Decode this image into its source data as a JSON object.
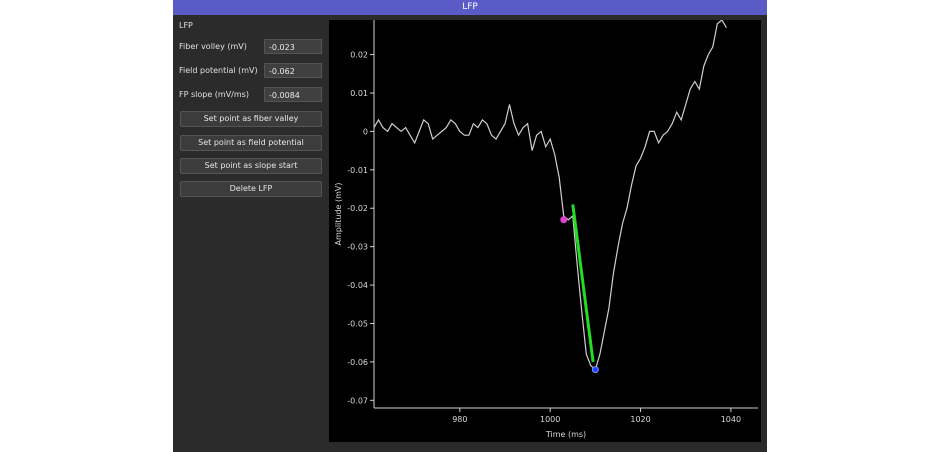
{
  "window": {
    "title": "LFP"
  },
  "panel": {
    "title": "LFP",
    "rows": [
      {
        "label": "Fiber volley (mV)",
        "value": "-0.023"
      },
      {
        "label": "Field potential (mV)",
        "value": "-0.062"
      },
      {
        "label": "FP slope (mV/ms)",
        "value": "-0.0084"
      }
    ],
    "buttons": [
      "Set point as fiber valley",
      "Set point as field potential",
      "Set point as slope start",
      "Delete LFP"
    ]
  },
  "chart_data": {
    "type": "line",
    "xlabel": "Time (ms)",
    "ylabel": "Amplitude (mV)",
    "xlim": [
      961,
      1046
    ],
    "ylim": [
      -0.072,
      0.029
    ],
    "xticks": [
      980,
      1000,
      1020,
      1040
    ],
    "yticks": [
      0.02,
      0.01,
      0,
      -0.01,
      -0.02,
      -0.03,
      -0.04,
      -0.05,
      -0.06,
      -0.07
    ],
    "colors": {
      "trace": "#cfcfcf",
      "slope": "#22dd22",
      "fiber_marker": "#e040d0",
      "fp_marker": "#2040ff"
    },
    "series": [
      {
        "x": [
          961,
          962,
          963,
          964,
          965,
          966,
          967,
          968,
          969,
          970,
          971,
          972,
          973,
          974,
          975,
          976,
          977,
          978,
          979,
          980,
          981,
          982,
          983,
          984,
          985,
          986,
          987,
          988,
          989,
          990,
          991,
          992,
          993,
          994,
          995,
          996,
          997,
          998,
          999,
          1000,
          1001,
          1002,
          1003,
          1004,
          1005,
          1006,
          1007,
          1008,
          1009,
          1010,
          1011,
          1012,
          1013,
          1014,
          1015,
          1016,
          1017,
          1018,
          1019,
          1020,
          1021,
          1022,
          1023,
          1024,
          1025,
          1026,
          1027,
          1028,
          1029,
          1030,
          1031,
          1032,
          1033,
          1034,
          1035,
          1036,
          1037,
          1038,
          1039
        ],
        "y": [
          0.001,
          0.003,
          0.001,
          0.0,
          0.002,
          0.001,
          0.0,
          0.001,
          -0.001,
          -0.003,
          0.0,
          0.003,
          0.002,
          -0.002,
          -0.001,
          0.0,
          0.001,
          0.003,
          0.002,
          0.0,
          -0.001,
          -0.001,
          0.002,
          0.001,
          0.003,
          0.002,
          -0.001,
          -0.002,
          0.0,
          0.002,
          0.007,
          0.002,
          -0.001,
          0.001,
          0.002,
          -0.005,
          -0.001,
          0.0,
          -0.004,
          -0.002,
          -0.006,
          -0.012,
          -0.022,
          -0.023,
          -0.022,
          -0.035,
          -0.047,
          -0.058,
          -0.061,
          -0.062,
          -0.058,
          -0.052,
          -0.046,
          -0.037,
          -0.03,
          -0.024,
          -0.02,
          -0.014,
          -0.009,
          -0.007,
          -0.004,
          0.0,
          0.0,
          -0.003,
          -0.001,
          0.0,
          0.002,
          0.005,
          0.003,
          0.007,
          0.011,
          0.013,
          0.011,
          0.017,
          0.02,
          0.022,
          0.028,
          0.029,
          0.027
        ]
      }
    ],
    "slope_line": {
      "x": [
        1005,
        1009.5
      ],
      "y": [
        -0.019,
        -0.06
      ]
    },
    "markers": [
      {
        "name": "fiber valley",
        "x": 1003,
        "y": -0.023
      },
      {
        "name": "field potential",
        "x": 1010,
        "y": -0.062
      }
    ]
  }
}
